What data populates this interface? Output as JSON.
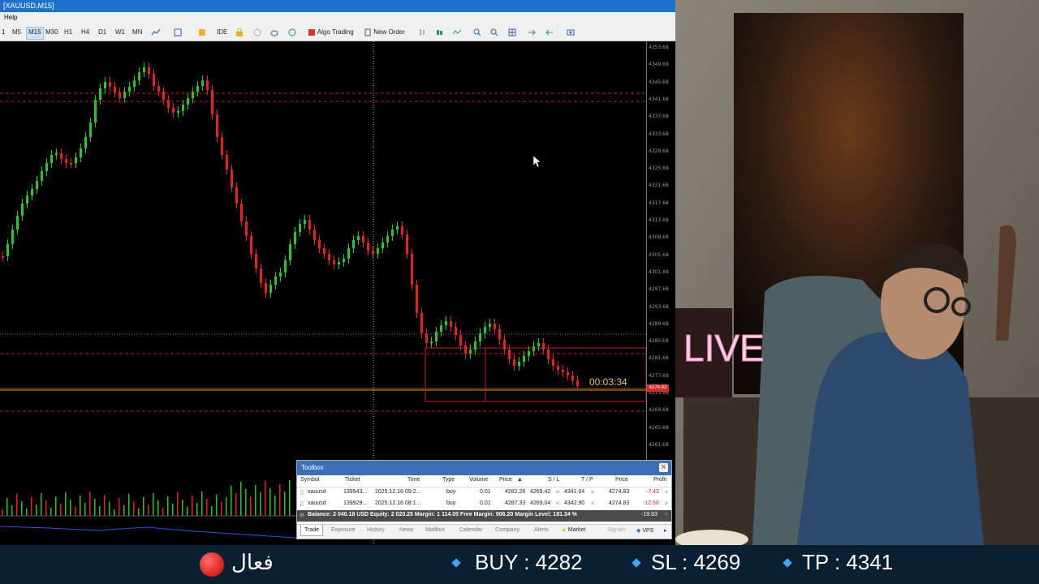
{
  "window": {
    "title": "[XAUUSD,M15]"
  },
  "menu": {
    "help": "Help"
  },
  "toolbar": {
    "timeframes": [
      "1",
      "M5",
      "M15",
      "M30",
      "H1",
      "H4",
      "D1",
      "W1",
      "MN"
    ],
    "active_timeframe": "M15",
    "ide": "IDE",
    "algo_trading": "Algo Trading",
    "new_order": "New Order"
  },
  "price_axis": [
    "4353.68",
    "4349.68",
    "4345.68",
    "4341.68",
    "4337.68",
    "4333.68",
    "4329.68",
    "4325.68",
    "4321.68",
    "4317.68",
    "4313.68",
    "4309.68",
    "4305.68",
    "4301.68",
    "4297.68",
    "4293.68",
    "4289.68",
    "4285.68",
    "4281.68",
    "4277.68",
    "4273.68",
    "4269.68",
    "4265.68",
    "4261.68"
  ],
  "chart": {
    "countdown": "00:03:34",
    "current_price_tag": "4274.83",
    "colors": {
      "bull": "#22c92b",
      "bear": "#e82020",
      "level_line": "#b22222",
      "timer": "#e7c64b"
    }
  },
  "toolbox": {
    "title": "Toolbox",
    "headers": [
      "Symbol",
      "Ticket",
      "Time",
      "Type",
      "Volume",
      "Price",
      "S / L",
      "T / P",
      "Price",
      "Profit"
    ],
    "rows": [
      {
        "symbol": "xauusd",
        "ticket": "139943...",
        "time": "2025.12.16 09:2...",
        "type": "buy",
        "volume": "0.01",
        "price": "4282.26",
        "sl": "4269.42",
        "tp": "4341.04",
        "cur": "4274.83",
        "profit": "-7.43"
      },
      {
        "symbol": "xauusd",
        "ticket": "139929...",
        "time": "2025.12.16 08:1...",
        "type": "buy",
        "volume": "0.01",
        "price": "4287.33",
        "sl": "4269.04",
        "tp": "4342.90",
        "cur": "4274.83",
        "profit": "-12.50"
      }
    ],
    "balance_line": "Balance: 2 040.18 USD  Equity: 2 020.25  Margin: 1 114.05  Free Margin: 906.20  Margin Level: 181.34 %",
    "total_profit": "-19.93",
    "tabs": [
      "Trade",
      "Exposure",
      "History",
      "News",
      "Mailbox",
      "Calendar",
      "Company",
      "Alerts",
      "Market",
      "Signals",
      "VPS"
    ]
  },
  "camera": {
    "live_sign": "LIVE"
  },
  "bottom_bar": {
    "status": "فعال",
    "buy": "BUY : 4282",
    "sl": "SL : 4269",
    "tp": "TP : 4341"
  }
}
